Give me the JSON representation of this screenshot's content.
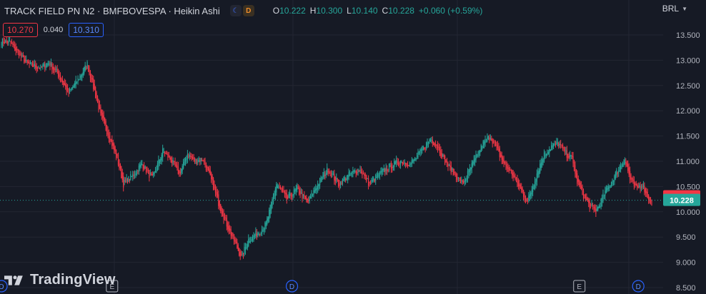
{
  "header": {
    "title": "TRACK FIELD PN N2 · BMFBOVESPA · Heikin Ashi",
    "session_icons": [
      "moon-icon",
      "D"
    ],
    "ohlc": {
      "o_label": "O",
      "o_value": "10.222",
      "h_label": "H",
      "h_value": "10.300",
      "l_label": "L",
      "l_value": "10.140",
      "c_label": "C",
      "c_value": "10.228",
      "change": "+0.060 (+0.59%)"
    }
  },
  "trade": {
    "sell_price": "10.270",
    "spread": "0.040",
    "buy_price": "10.310"
  },
  "currency": "BRL",
  "branding": {
    "name": "TradingView"
  },
  "colors": {
    "background": "#161a25",
    "up": "#26a69a",
    "down": "#f23645",
    "grid": "#232632",
    "axis_text": "#b2b5be"
  },
  "chart_data": {
    "type": "candlestick",
    "style": "Heikin Ashi",
    "y_axis": {
      "ticks": [
        "13.500",
        "13.000",
        "12.500",
        "12.000",
        "11.500",
        "11.000",
        "10.500",
        "10.000",
        "9.500",
        "9.000",
        "8.500"
      ],
      "tick_values": [
        13.5,
        13.0,
        12.5,
        12.0,
        11.5,
        11.0,
        10.5,
        10.0,
        9.5,
        9.0,
        8.5
      ],
      "side": "right"
    },
    "price_labels": [
      {
        "text": "10.300",
        "value": 10.3,
        "color": "#f23645"
      },
      {
        "text": "10.228",
        "value": 10.228,
        "color": "#26a69a"
      }
    ],
    "last_price_line": 10.228,
    "markers": [
      {
        "label": "D",
        "kind": "dividend",
        "bar_index": 0
      },
      {
        "label": "E",
        "kind": "earnings",
        "bar_index": 107
      },
      {
        "label": "D",
        "kind": "dividend",
        "bar_index": 281
      },
      {
        "label": "E",
        "kind": "earnings",
        "bar_index": 559
      },
      {
        "label": "D",
        "kind": "dividend",
        "bar_index": 616
      }
    ],
    "path": [
      [
        0,
        13.38
      ],
      [
        8,
        13.35
      ],
      [
        15,
        13.18
      ],
      [
        25,
        12.92
      ],
      [
        38,
        12.85
      ],
      [
        46,
        12.95
      ],
      [
        55,
        12.72
      ],
      [
        65,
        12.35
      ],
      [
        75,
        12.65
      ],
      [
        83,
        12.92
      ],
      [
        88,
        12.55
      ],
      [
        96,
        11.9
      ],
      [
        105,
        11.45
      ],
      [
        112,
        11.05
      ],
      [
        118,
        10.55
      ],
      [
        126,
        10.7
      ],
      [
        136,
        10.95
      ],
      [
        146,
        10.65
      ],
      [
        156,
        11.2
      ],
      [
        163,
        11.05
      ],
      [
        172,
        10.75
      ],
      [
        180,
        11.15
      ],
      [
        187,
        11.0
      ],
      [
        195,
        11.05
      ],
      [
        203,
        10.62
      ],
      [
        210,
        10.18
      ],
      [
        218,
        9.75
      ],
      [
        226,
        9.38
      ],
      [
        232,
        9.1
      ],
      [
        239,
        9.45
      ],
      [
        248,
        9.58
      ],
      [
        256,
        9.75
      ],
      [
        266,
        10.55
      ],
      [
        276,
        10.25
      ],
      [
        286,
        10.45
      ],
      [
        296,
        10.18
      ],
      [
        306,
        10.55
      ],
      [
        316,
        10.85
      ],
      [
        326,
        10.55
      ],
      [
        336,
        10.72
      ],
      [
        346,
        10.85
      ],
      [
        356,
        10.55
      ],
      [
        366,
        10.75
      ],
      [
        376,
        10.9
      ],
      [
        386,
        11.0
      ],
      [
        396,
        10.95
      ],
      [
        406,
        11.2
      ],
      [
        415,
        11.45
      ],
      [
        422,
        11.3
      ],
      [
        430,
        10.95
      ],
      [
        438,
        10.75
      ],
      [
        446,
        10.55
      ],
      [
        456,
        10.95
      ],
      [
        466,
        11.35
      ],
      [
        473,
        11.5
      ],
      [
        479,
        11.25
      ],
      [
        486,
        10.95
      ],
      [
        494,
        10.75
      ],
      [
        502,
        10.45
      ],
      [
        509,
        10.2
      ],
      [
        516,
        10.65
      ],
      [
        524,
        11.1
      ],
      [
        532,
        11.3
      ],
      [
        539,
        11.35
      ],
      [
        546,
        11.15
      ],
      [
        552,
        11.05
      ],
      [
        556,
        10.65
      ],
      [
        561,
        10.4
      ],
      [
        568,
        10.15
      ],
      [
        575,
        10.0
      ],
      [
        583,
        10.35
      ],
      [
        590,
        10.6
      ],
      [
        597,
        10.85
      ],
      [
        603,
        11.05
      ],
      [
        608,
        10.65
      ],
      [
        614,
        10.45
      ],
      [
        620,
        10.55
      ],
      [
        624,
        10.35
      ],
      [
        629,
        10.15
      ]
    ]
  }
}
